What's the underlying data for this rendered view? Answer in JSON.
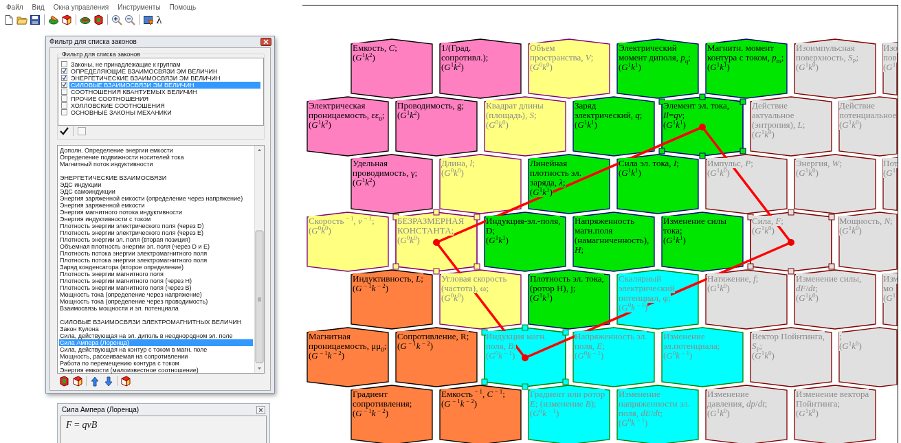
{
  "menu": [
    "Файл",
    "Вид",
    "Окна управления",
    "Инструменты",
    "Помощь"
  ],
  "toolbar": {
    "lambda": "λ"
  },
  "filter_window": {
    "title": "Фильтр для списка законов",
    "group_title": "Фильтр для списка законов",
    "items": [
      {
        "label": "Законы, не принадлежащие к группам",
        "checked": false,
        "selected": false
      },
      {
        "label": "ОПРЕДЕЛЯЮЩИЕ ВЗАИМОСВЯЗИ ЭМ ВЕЛИЧИН",
        "checked": true,
        "selected": false
      },
      {
        "label": "ЭНЕРГЕТИЧЕСКИЕ ВЗАИМОСВЯЗИ ЭМ ВЕЛИЧИН",
        "checked": true,
        "selected": false
      },
      {
        "label": "СИЛОВЫЕ ВЗАИМОСВЯЗИ ЭМ ВЕЛИЧИН",
        "checked": true,
        "selected": true
      },
      {
        "label": "СООТНОШЕНИЯ КВАНТУЕМЫХ ВЕЛИЧИН",
        "checked": false,
        "selected": false
      },
      {
        "label": "ПРОЧИЕ СООТНОШЕНИЯ",
        "checked": false,
        "selected": false
      },
      {
        "label": "ХОЛЛОВСКИЕ СООТНОШЕНИЯ",
        "checked": false,
        "selected": false
      },
      {
        "label": "ОСНОВНЫЕ ЗАКОНЫ МЕХАНИКИ",
        "checked": false,
        "selected": false
      }
    ]
  },
  "law_list": {
    "sections": [
      {
        "items": [
          {
            "label": "Дополн. Определение энергии емкости",
            "selected": false
          },
          {
            "label": "Определение подвижности носителей тока",
            "selected": false
          },
          {
            "label": "Магнитный поток индуктивности",
            "selected": false
          }
        ]
      },
      {
        "title": "ЭНЕРГЕТИЧЕСКИЕ ВЗАИМОСВЯЗИ",
        "items": [
          {
            "label": "ЭДС индукции",
            "selected": false
          },
          {
            "label": "ЭДС самоиндукции",
            "selected": false
          },
          {
            "label": "Энергия заряженной емкости (определение через напряжение)",
            "selected": false
          },
          {
            "label": "Энергия заряженной емкости",
            "selected": false
          },
          {
            "label": "Энергия магнитного потока индуктивности",
            "selected": false
          },
          {
            "label": "Энергия индуктивности с током",
            "selected": false
          },
          {
            "label": "Плотность энергии электрического поля (через D)",
            "selected": false
          },
          {
            "label": "Плотность энергии электрического поля (через E)",
            "selected": false
          },
          {
            "label": "Плотность энергии эл. поля (вторая позиция)",
            "selected": false
          },
          {
            "label": "Объемная плотность энергии эл. поля (через D и E)",
            "selected": false
          },
          {
            "label": "Плотность потока энергии электромагнитного поля",
            "selected": false
          },
          {
            "label": "Плотность потока энергии электромагнитного поля",
            "selected": false
          },
          {
            "label": "Заряд конденсатора (второе определение)",
            "selected": false
          },
          {
            "label": "Плотность энергии магнитного поля",
            "selected": false
          },
          {
            "label": "Плотность энергии магнитного поля (через H)",
            "selected": false
          },
          {
            "label": "Плотность энергии магнитного поля (через B)",
            "selected": false
          },
          {
            "label": "Мощность тока (определение через напряжение)",
            "selected": false
          },
          {
            "label": "Мощность тока (определение через проводимость)",
            "selected": false
          },
          {
            "label": "Взаимосвязь мощности и эл. потенциала",
            "selected": false
          }
        ]
      },
      {
        "title": "СИЛОВЫЕ ВЗАИМОСВЯЗИ ЭЛЕКТРОМАГНИТНЫХ ВЕЛИЧИН",
        "items": [
          {
            "label": "Закон Кулона",
            "selected": false
          },
          {
            "label": "Сила, действующая на эл. диполь в неоднородном эл. поле",
            "selected": false
          },
          {
            "label": "Сила Ампера (Лоренца)",
            "selected": true
          },
          {
            "label": "Сила, действующая на контур с током в магн. поле",
            "selected": false
          },
          {
            "label": "Мощность, рассеиваемая на сопротивлении",
            "selected": false
          },
          {
            "label": "Работа по перемещению контура с током",
            "selected": false
          },
          {
            "label": "Энергия емкости (малоизвестное соотношение)",
            "selected": false
          }
        ]
      }
    ]
  },
  "formula_window": {
    "title": "Сила Ампера (Лоренца)",
    "formula": "*F* = *qvB*"
  },
  "hex_grid": {
    "rows": [
      {
        "cells": [
          {
            "name": "Емкость, *C*;",
            "dimension": "(*G*$^{1}$*k*$^{2}$)",
            "color": "#ff80c0",
            "dimmed": false,
            "selected": false
          },
          {
            "name": "1/(Град. сопротивл.);",
            "dimension": "(*G*$^{1}$*k*$^{2}$)",
            "color": "#ff80c0",
            "dimmed": false,
            "selected": false
          },
          {
            "name": "Объем пространства, *V*;",
            "dimension": "(*G*$^{0}$*k*$^{0}$)",
            "color": "#ffff80",
            "dimmed": true,
            "selected": false
          },
          {
            "name": "Электрический момент диполя, *p*$_{q}$;",
            "dimension": "(*G*$^{1}$*k*$^{1}$)",
            "color": "#00e600",
            "dimmed": false,
            "selected": false
          },
          {
            "name": "Магнитн. момент контура с током, *p*$_{m}$;",
            "dimension": "(*G*$^{1}$*k*$^{1}$)",
            "color": "#00e600",
            "dimmed": false,
            "selected": false
          },
          {
            "name": "Изоимпульсная поверхность, *S*$_{P}$;",
            "dimension": "(*G*$^{1}$*k*$^{0}$)",
            "color": "#e0e0e0",
            "dimmed": true,
            "selected": false
          },
          {
            "name": "Изо пов",
            "dimension": "(*G*$^{1}$",
            "color": "#e0e0e0",
            "dimmed": true,
            "selected": false
          }
        ]
      },
      {
        "cells": [
          {
            "name": "Электрическая проницаемость, εε$_{0}$;",
            "dimension": "(*G*$^{1}$*k*$^{2}$)",
            "color": "#ff80c0",
            "dimmed": false,
            "selected": false
          },
          {
            "name": "Проводимость, g;",
            "dimension": "(*G*$^{1}$*k*$^{2}$)",
            "color": "#ff80c0",
            "dimmed": false,
            "selected": false
          },
          {
            "name": "Квадрат длины (площадь), *S*;",
            "dimension": "(*G*$^{0}$*k*$^{0}$)",
            "color": "#ffff80",
            "dimmed": true,
            "selected": false
          },
          {
            "name": "Заряд электрический, *q*;",
            "dimension": "(*G*$^{1}$*k*$^{1}$)",
            "color": "#00e600",
            "dimmed": false,
            "selected": false
          },
          {
            "name": "Элемент эл. тока, *Il*=*qv*;",
            "dimension": "(*G*$^{1}$*k*$^{1}$)",
            "color": "#00e600",
            "dimmed": false,
            "selected": true
          },
          {
            "name": "Действие актуальное (энтропия), *L*;",
            "dimension": "(*G*$^{1}$*k*$^{0}$)",
            "color": "#e0e0e0",
            "dimmed": true,
            "selected": false
          },
          {
            "name": "Действие потенциальное",
            "dimension": "(*G*$^{1}$*k*$^{0}$)",
            "color": "#e0e0e0",
            "dimmed": true,
            "selected": false
          }
        ]
      },
      {
        "cells": [
          {
            "name": "Удельная проводимость, γ;",
            "dimension": "(*G*$^{1}$*k*$^{2}$)",
            "color": "#ff80c0",
            "dimmed": false,
            "selected": false
          },
          {
            "name": "Длина, *l*;",
            "dimension": "(*G*$^{0}$*k*$^{0}$)",
            "color": "#ffff80",
            "dimmed": true,
            "selected": false
          },
          {
            "name": "Линейная плотность эл. заряда, *λ*;",
            "dimension": "(*G*$^{1}$*k*$^{1}$)",
            "color": "#00e600",
            "dimmed": false,
            "selected": false
          },
          {
            "name": "Сила эл. тока, *I*;",
            "dimension": "(*G*$^{1}$*k*$^{1}$)",
            "color": "#00e600",
            "dimmed": false,
            "selected": false
          },
          {
            "name": "Импульс, *P*;",
            "dimension": "(*G*$^{1}$*k*$^{0}$)",
            "color": "#e0e0e0",
            "dimmed": true,
            "selected": false
          },
          {
            "name": "Энергия, *W*;",
            "dimension": "(*G*$^{1}$*k*$^{0}$)",
            "color": "#e0e0e0",
            "dimmed": true,
            "selected": false
          },
          {
            "name": "Пот",
            "dimension": "(*G*$^{1}$",
            "color": "#e0e0e0",
            "dimmed": true,
            "selected": false
          }
        ]
      },
      {
        "cells": [
          {
            "name": "Скорость$^{ − 1}$, *v*$^{ − 1}$;",
            "dimension": "(*G*$^{0}$*k*$^{0}$)",
            "color": "#ffff80",
            "dimmed": true,
            "selected": false
          },
          {
            "name": "БЕЗРАЗМЕРНАЯ КОНСТАНТА;",
            "dimension": "(*G*$^{0}$*k*$^{0}$)",
            "color": "#ffff80",
            "dimmed": true,
            "selected": true
          },
          {
            "name": "Индукция-эл.-поля, D;",
            "dimension": "(*G*$^{1}$*k*$^{1}$)",
            "color": "#00e600",
            "dimmed": false,
            "selected": false
          },
          {
            "name": "Напряженность магн.поля (намагниченность), *H*;",
            "color": "#00e600",
            "dimmed": false,
            "selected": false
          },
          {
            "name": "Изменение силы тока;",
            "dimension": "(*G*$^{1}$*k*$^{1}$)",
            "color": "#00e600",
            "dimmed": false,
            "selected": false
          },
          {
            "name": "Сила, *F*;",
            "dimension": "(*G*$^{1}$*k*$^{0}$)",
            "color": "#e0e0e0",
            "dimmed": true,
            "selected": true
          },
          {
            "name": "Мощность, *N*;",
            "dimension": "(*G*$^{1}$*k*$^{0}$)",
            "color": "#e0e0e0",
            "dimmed": true,
            "selected": false
          }
        ]
      },
      {
        "cells": [
          {
            "name": "Индуктивность, *L*;",
            "dimension": "(*G*$^{ − 1}$*k*$^{ − 2}$)",
            "color": "#ff8040",
            "dimmed": false,
            "selected": false
          },
          {
            "name": "Угловая скорость (частота), ω;",
            "dimension": "(*G*$^{0}$*k*$^{0}$)",
            "color": "#ffff80",
            "dimmed": true,
            "selected": false
          },
          {
            "name": "Плотность эл. тока, (ротор H), j;",
            "dimension": "(*G*$^{1}$*k*$^{1}$)",
            "color": "#00e600",
            "dimmed": false,
            "selected": false
          },
          {
            "name": "Скалярный электрический потенциал, φ;",
            "dimension": "(*G*$^{0}$*k*$^{ − 1}$)",
            "color": "#00ffff",
            "dimmed": true,
            "selected": false
          },
          {
            "name": "Натяжение, *f*;",
            "dimension": "(*G*$^{1}$*k*$^{0}$)",
            "color": "#e0e0e0",
            "dimmed": true,
            "selected": false
          },
          {
            "name": "Изменение силы, *dF*/*dt*;",
            "dimension": "(*G*$^{1}$*k*$^{0}$)",
            "color": "#e0e0e0",
            "dimmed": true,
            "selected": false
          },
          {
            "name": "Изм мо",
            "dimension": "(*G*$^{1}$",
            "color": "#e0e0e0",
            "dimmed": true,
            "selected": false
          }
        ]
      },
      {
        "cells": [
          {
            "name": "Магнитная проницаемость, μμ$_{0}$;",
            "dimension": "(*G*$^{ − 1}$*k*$^{ − 2}$)",
            "color": "#ff8040",
            "dimmed": false,
            "selected": false
          },
          {
            "name": "Сопротивление, R;",
            "dimension": "(*G*$^{ − 1}$*k*$^{ − 2}$)",
            "color": "#ff8040",
            "dimmed": false,
            "selected": false
          },
          {
            "name": "Индукция магн. поля, *B*;",
            "dimension": "(*G*$^{0}$*k*$^{ − 1}$)",
            "color": "#00ffff",
            "dimmed": true,
            "selected": true
          },
          {
            "name": "Напряженность эл. поля, *E*;",
            "dimension": "(*G*$^{0}$*k*$^{ − 1}$)",
            "color": "#00ffff",
            "dimmed": true,
            "selected": false
          },
          {
            "name": "Изменение эл.потенциала;",
            "dimension": "(*G*$^{0}$*k*$^{ − 1}$)",
            "color": "#00ffff",
            "dimmed": true,
            "selected": false
          },
          {
            "name": "Вектор Пойнтинга, *S*$_{P}$;",
            "dimension": "(*G*$^{1}$*k*$^{0}$)",
            "color": "#e0e0e0",
            "dimmed": true,
            "selected": false
          },
          {
            "name": ";",
            "dimension": "(*G*$^{1}$*k*$^{0}$)",
            "color": "#e0e0e0",
            "dimmed": true,
            "selected": false
          }
        ]
      },
      {
        "cells": [
          {
            "name": "Градиент сопротивления;",
            "dimension": "(*G*$^{ − 1}$*k*$^{ − 2}$)",
            "color": "#ff8040",
            "dimmed": false,
            "selected": false
          },
          {
            "name": "Емкость$^{ − 1}$, *C*$^{ − 1}$;",
            "dimension": "(*G*$^{ − 1}$*k*$^{ − 2}$)",
            "color": "#ff8040",
            "dimmed": false,
            "selected": false
          },
          {
            "name": "Градиент или ротор *E*; (изменение *B*);",
            "dimension": "(*G*$^{0}$*k*$^{ − 1}$)",
            "color": "#00ffff",
            "dimmed": true,
            "selected": false
          },
          {
            "name": "Изменение напряженности эл. поля, *dE*/*dt*;",
            "dimension": "(*G*$^{0}$*k*$^{ − 1}$)",
            "color": "#00ffff",
            "dimmed": true,
            "selected": false
          },
          {
            "name": "Изменение давления, *dp*/*dt*;",
            "dimension": "(*G*$^{1}$*k*$^{0}$)",
            "color": "#e0e0e0",
            "dimmed": true,
            "selected": false
          },
          {
            "name": "Изменение вектора Пойнтинга;",
            "dimension": "(*G*$^{1}$*k*$^{0}$)",
            "color": "#e0e0e0",
            "dimmed": true,
            "selected": false
          }
        ]
      }
    ]
  }
}
